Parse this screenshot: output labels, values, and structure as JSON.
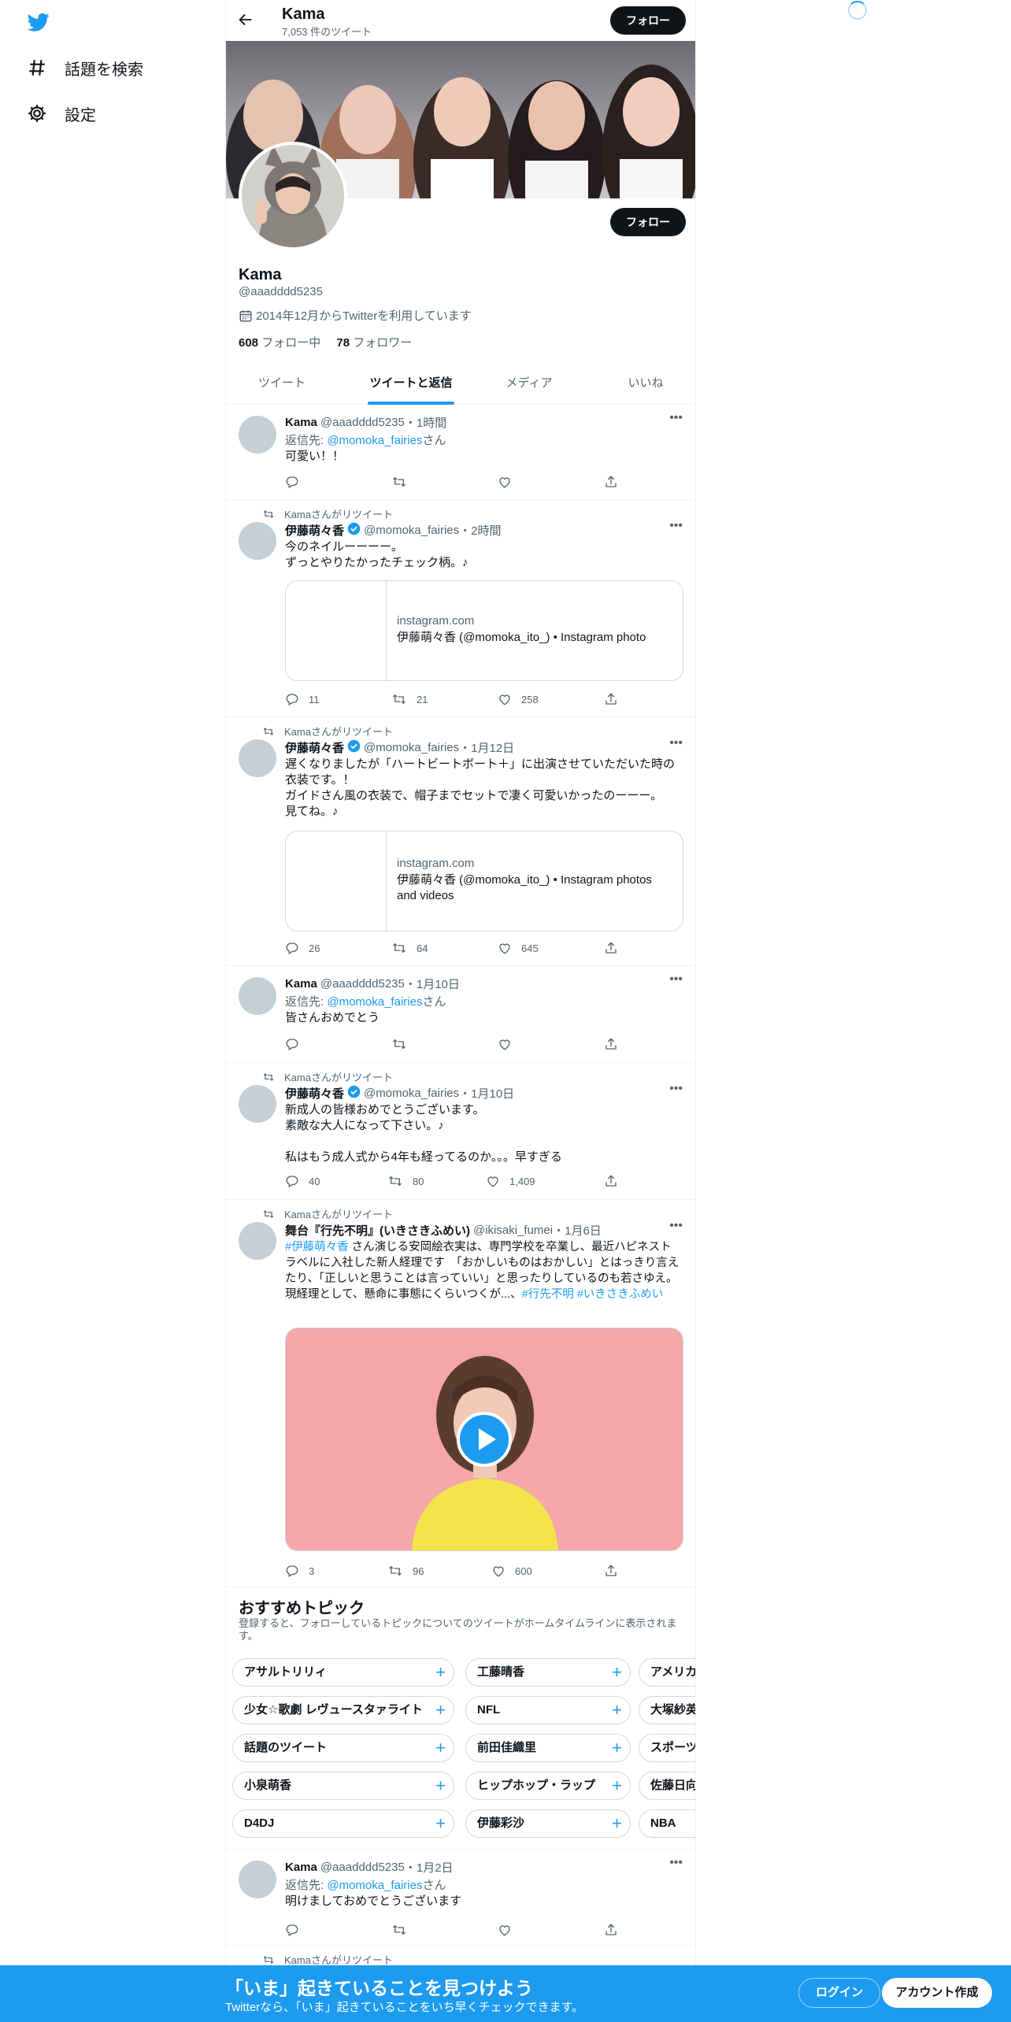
{
  "nav": {
    "explore": "話題を検索",
    "settings": "設定"
  },
  "header": {
    "name": "Kama",
    "tweet_count": "7,053 件のツイート",
    "follow_label": "フォロー"
  },
  "profile": {
    "name": "Kama",
    "handle": "@aaadddd5235",
    "joined": "2014年12月からTwitterを利用しています",
    "following_count": "608",
    "following_label": "フォロー中",
    "followers_count": "78",
    "followers_label": "フォロワー",
    "follow_label": "フォロー"
  },
  "tabs": [
    "ツイート",
    "ツイートと返信",
    "メディア",
    "いいね"
  ],
  "active_tab": "ツイートと返信",
  "retweet_label": "Kamaさんがリツイート",
  "tweets": [
    {
      "name": "Kama",
      "handle": "@aaadddd5235",
      "time": "1時間",
      "reply_prefix": "返信先: ",
      "reply_to": "@momoka_fairies",
      "reply_suffix": "さん",
      "text": "可愛い！！"
    },
    {
      "name": "伊藤萌々香",
      "handle": "@momoka_fairies",
      "time": "2時間",
      "text": "今のネイルーーーー。\nずっとやりたかったチェック柄。♪",
      "card_domain": "instagram.com",
      "card_title": "伊藤萌々香 (@momoka_ito_) • Instagram photo",
      "replies": "11",
      "retweets": "21",
      "likes": "258"
    },
    {
      "name": "伊藤萌々香",
      "handle": "@momoka_fairies",
      "time": "1月12日",
      "text": "遅くなりましたが「ハートビートボート＋」に出演させていただいた時の衣装です。！\nガイドさん風の衣装で、帽子までセットで凄く可愛いかったのーーー。\n見てね。♪",
      "card_domain": "instagram.com",
      "card_title": "伊藤萌々香 (@momoka_ito_) • Instagram photos and videos",
      "replies": "26",
      "retweets": "64",
      "likes": "645"
    },
    {
      "name": "Kama",
      "handle": "@aaadddd5235",
      "time": "1月10日",
      "reply_prefix": "返信先: ",
      "reply_to": "@momoka_fairies",
      "reply_suffix": "さん",
      "text": "皆さんおめでとう"
    },
    {
      "name": "伊藤萌々香",
      "handle": "@momoka_fairies",
      "time": "1月10日",
      "text": "新成人の皆様おめでとうございます。\n素敵な大人になって下さい。♪\n\n私はもう成人式から4年も経ってるのか。。。早すぎる",
      "replies": "40",
      "retweets": "80",
      "likes": "1,409"
    },
    {
      "name": "舞台『行先不明』(いきさきふめい)",
      "handle": "@ikisaki_fumei",
      "time": "1月6日",
      "text_link1": "#伊藤萌々香",
      "text_body": " さん演じる安岡絵衣実は、専門学校を卒業し、最近ハピネストラベルに入社した新人経理です　「おかしいものはおかしい」とはっきり言えたり、「正しいと思うことは言っていい」と思ったりしているのも若さゆえ。現経理として、懸命に事態にくらいつくが...、",
      "text_link2": "#行先不明 #いきさきふめい",
      "replies": "3",
      "retweets": "96",
      "likes": "600"
    },
    {
      "name": "Kama",
      "handle": "@aaadddd5235",
      "time": "1月2日",
      "reply_prefix": "返信先: ",
      "reply_to": "@momoka_fairies",
      "reply_suffix": "さん",
      "text": "明けましておめでとうございます"
    }
  ],
  "topics": {
    "title": "おすすめトピック",
    "description": "登録すると、フォローしているトピックについてのツイートがホームタイムラインに表示されます。",
    "items": [
      [
        "アサルトリリィ",
        "工藤晴香",
        "アメリカ"
      ],
      [
        "少女☆歌劇 レヴュースタァライト",
        "NFL",
        "大塚紗英"
      ],
      [
        "話題のツイート",
        "前田佳織里",
        "スポーツ"
      ],
      [
        "小泉萌香",
        "ヒップホップ・ラップ",
        "佐藤日向"
      ],
      [
        "D4DJ",
        "伊藤彩沙",
        "NBA"
      ]
    ]
  },
  "bottom_bar": {
    "title": "「いま」起きていることを見つけよう",
    "subtitle": "Twitterなら、「いま」起きていることをいち早くチェックできます。",
    "login": "ログイン",
    "signup": "アカウント作成"
  },
  "colors": {
    "accent": "#1d9bf0",
    "text": "#0f1419",
    "muted": "#536471"
  }
}
